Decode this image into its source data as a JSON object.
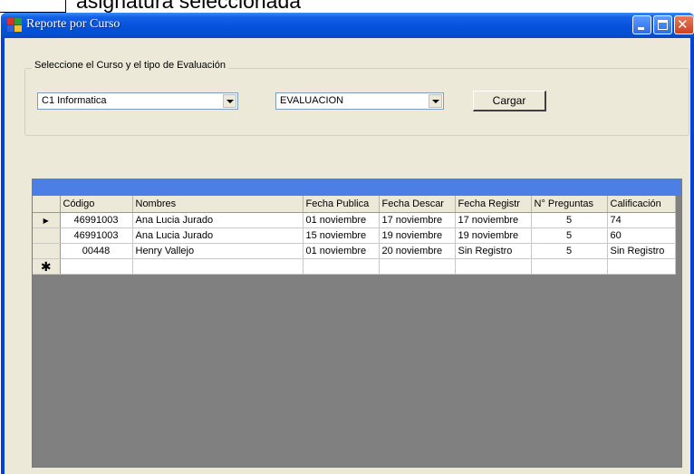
{
  "document": {
    "fragment_text": "asignatura seleccionada"
  },
  "window": {
    "title": "Reporte por Curso"
  },
  "group": {
    "legend": "Seleccione el Curso y el tipo de Evaluación"
  },
  "combo_curso": {
    "value": "C1 Informatica"
  },
  "combo_evaluacion": {
    "value": "EVALUACION"
  },
  "buttons": {
    "cargar": "Cargar"
  },
  "grid": {
    "columns": [
      "Código",
      "Nombres",
      "Fecha Publica",
      "Fecha Descar",
      "Fecha Registr",
      "N° Preguntas",
      "Calificación"
    ],
    "rows": [
      [
        "46991003",
        "Ana Lucia Jurado",
        "01 noviembre",
        "17 noviembre",
        "17 noviembre",
        "5",
        "74"
      ],
      [
        "46991003",
        "Ana Lucia Jurado",
        "15 noviembre",
        "19 noviembre",
        "19 noviembre",
        "5",
        "60"
      ],
      [
        "00448",
        "Henry Vallejo",
        "01 noviembre",
        "20 noviembre",
        "Sin Registro",
        "5",
        "Sin Registro"
      ]
    ],
    "current_row_marker": "▶",
    "new_row_marker": "✱"
  },
  "icons": {
    "app": "app-window-icon",
    "minimize": "minimize-icon",
    "maximize": "maximize-icon",
    "close": "close-icon"
  },
  "colors": {
    "titlebar": "#0552dc",
    "grid_caption": "#4b7fe5",
    "grid_background": "#808080",
    "client": "#ece9d8"
  }
}
